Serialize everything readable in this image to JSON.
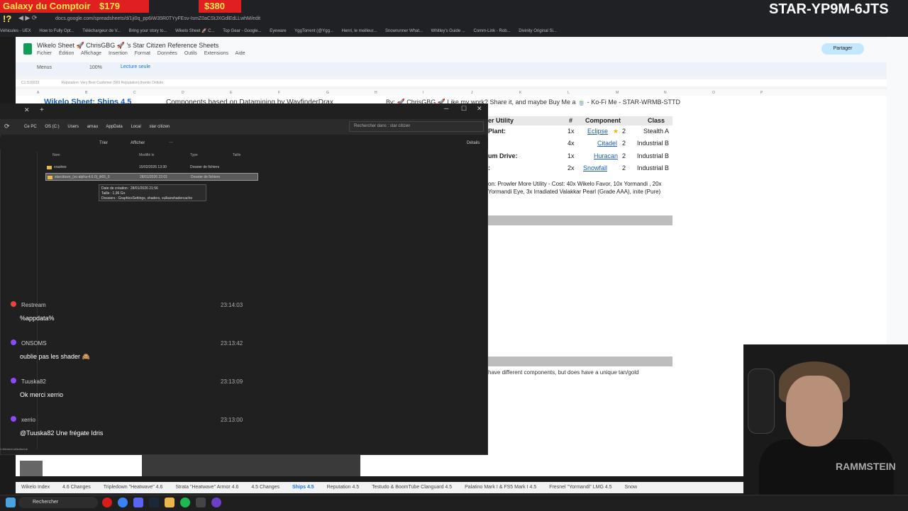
{
  "browser": {
    "promo_title": "Galaxy du Comptoir !?",
    "promo_price1": "$179",
    "promo_price2": "$380",
    "url": "docs.google.com/spreadsheets/d/1ji0q_pp6iW35R0TYyFEsv-IsmZ0aCStJXGdlEdLLwhM/edit",
    "stream_code": "STAR-YP9M-6JTS",
    "bookmarks": [
      "Véhicules - UEX",
      "How to Fully Opt...",
      "Téléchargeur de V...",
      "Bring your story to...",
      "Wikelo Sheet 🚀 C...",
      "Top Gear - Google...",
      "Eyeware",
      "YggTorrent (@Ygg...",
      "Henri, le meilleur...",
      "Snowrunner What...",
      "Whitley's Guide ...",
      "Comm-Link - Rob...",
      "Divinity Original Si..."
    ]
  },
  "sheets": {
    "doc_title": "Wikelo Sheet 🚀 ChrisGBG 🚀 's Star Citizen Reference Sheets",
    "menu": [
      "Fichier",
      "Édition",
      "Affichage",
      "Insertion",
      "Format",
      "Données",
      "Outils",
      "Extensions",
      "Aide"
    ],
    "toolbar_menus": "Menus",
    "zoom": "100%",
    "read_only": "Lecture seule",
    "share": "Partager",
    "formula": "Reputation: Very Best Customer (999 Reputation) thanks Orihide",
    "cell_ref": "C1:S16023",
    "columns": [
      "A",
      "B",
      "C",
      "D",
      "E",
      "F",
      "G",
      "H",
      "I",
      "J",
      "K",
      "L",
      "M",
      "N",
      "O",
      "P"
    ],
    "title_cell": "Wikelo Sheet: Ships 4.5",
    "subtitle": "Components based on Datamining by WayfinderDrax",
    "credits": "By: 🚀 ChrisGBG 🚀 Like my work? Share it, and maybe Buy Me a 🍵 - Ko-Fi Me - STAR-WRMB-STTD",
    "table_header": {
      "utility": "er Utility",
      "count": "#",
      "component": "Component",
      "class": "Class"
    },
    "rows": [
      {
        "label": "Plant:",
        "count": "1x",
        "component": "Eclipse",
        "grade": "2",
        "class": "Stealth A"
      },
      {
        "label": "",
        "count": "4x",
        "component": "Citadel",
        "grade": "2",
        "class": "Industrial B"
      },
      {
        "label": "um Drive:",
        "count": "1x",
        "component": "Huracan",
        "grade": "2",
        "class": "Industrial B"
      },
      {
        "label": ":",
        "count": "2x",
        "component": "Snowfall",
        "grade": "2",
        "class": "Industrial B"
      }
    ],
    "cost_text": "on: Prowler More Utility - Cost: 40x Wikelo Favor, 10x Yormandi , 20x Yormandi Eye, 3x Irradiated Valakkar Pearl (Grade AAA), inite (Pure)",
    "diff_text": "have different components, but does have a unique tan/gold",
    "tabs": [
      "Wikelo Index",
      "4.6 Changes",
      "Tripledown \"Heatwave\" 4.6",
      "Strata \"Heatwave\" Armor 4.6",
      "4.5 Changes",
      "Ships 4.5",
      "Reputation 4.5",
      "Testudo & BoomTube Clanguard 4.5",
      "Palatino Mark I & FS5 Mark I 4.5",
      "Fresnel \"Yormandi\" LMG 4.5",
      "Snow"
    ],
    "active_tab": "Ships 4.5"
  },
  "explorer": {
    "breadcrumb": [
      "Ce PC",
      "OS (C:)",
      "Users",
      "arnau",
      "AppData",
      "Local",
      "star citizen"
    ],
    "search_placeholder": "Rechercher dans : star citizen",
    "toolbar": {
      "sort": "Trier",
      "view": "Afficher",
      "more": "···",
      "details": "Détails"
    },
    "columns": {
      "name": "Nom",
      "modified": "Modifié le",
      "type": "Type",
      "size": "Taille"
    },
    "files": [
      {
        "name": "crashes",
        "modified": "15/02/2026 13:30",
        "type": "Dossier de fichiers"
      },
      {
        "name": "starcitizen_(sc-alpha-4.6.0)_ili65_0",
        "modified": "28/01/2026 22:01",
        "type": "Dossier de fichiers"
      }
    ],
    "tooltip": {
      "created": "Date de création : 28/01/2026 21:56",
      "size": "Taille : 1,96 Go",
      "folders": "Dossiers : GraphicsSettings, shaders, vulkanshadercache"
    },
    "status": "1 élément sélectionné"
  },
  "chat": [
    {
      "user": "Restream",
      "time": "23:14:03",
      "text": "%appdata%",
      "color": "#e8453c"
    },
    {
      "user": "ONSOMS",
      "time": "23:13:42",
      "text": "oublie pas les shader 🙈",
      "color": "#9146ff"
    },
    {
      "user": "Tuuska82",
      "time": "23:13:09",
      "text": "Ok merci xerrio",
      "color": "#9146ff"
    },
    {
      "user": "xerrio",
      "time": "23:13:00",
      "text": "@Tuuska82 Une frégate Idris",
      "color": "#9146ff"
    }
  ],
  "webcam": {
    "shirt_logo": "RAMMSTEIN"
  },
  "taskbar": {
    "search": "Rechercher"
  }
}
